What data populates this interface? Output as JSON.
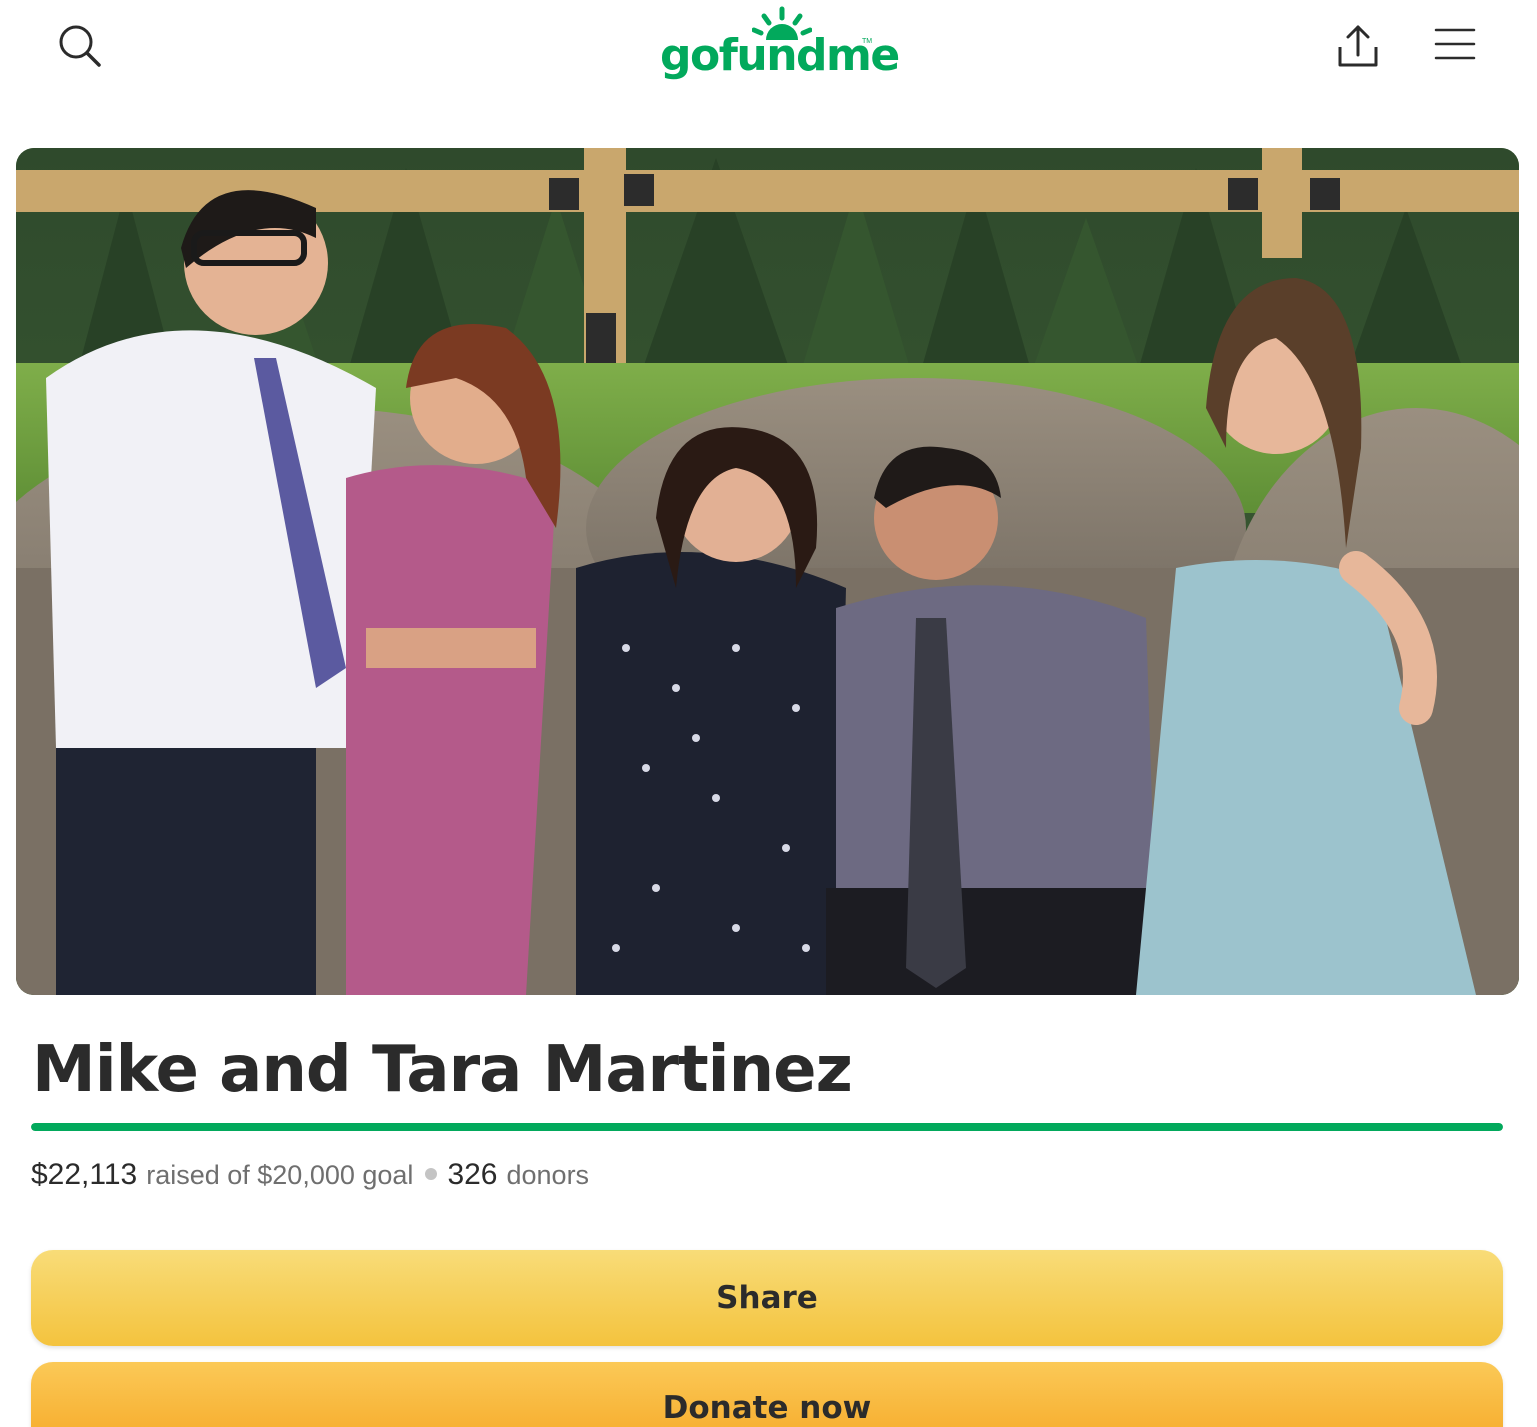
{
  "header": {
    "logo_text": "gofundme",
    "logo_tm": "TM",
    "brand_color": "#02a95c",
    "icons": {
      "search": "search-icon",
      "share": "share-upload-icon",
      "menu": "hamburger-menu-icon"
    }
  },
  "hero": {
    "content": "photo"
  },
  "fundraiser": {
    "title": "Mike and Tara Martinez",
    "progress_fraction": 1.0,
    "raised": "$22,113",
    "raised_suffix": "raised of $20,000 goal",
    "donor_count": "326",
    "donor_label": "donors"
  },
  "actions": {
    "share_label": "Share",
    "donate_label": "Donate now"
  }
}
